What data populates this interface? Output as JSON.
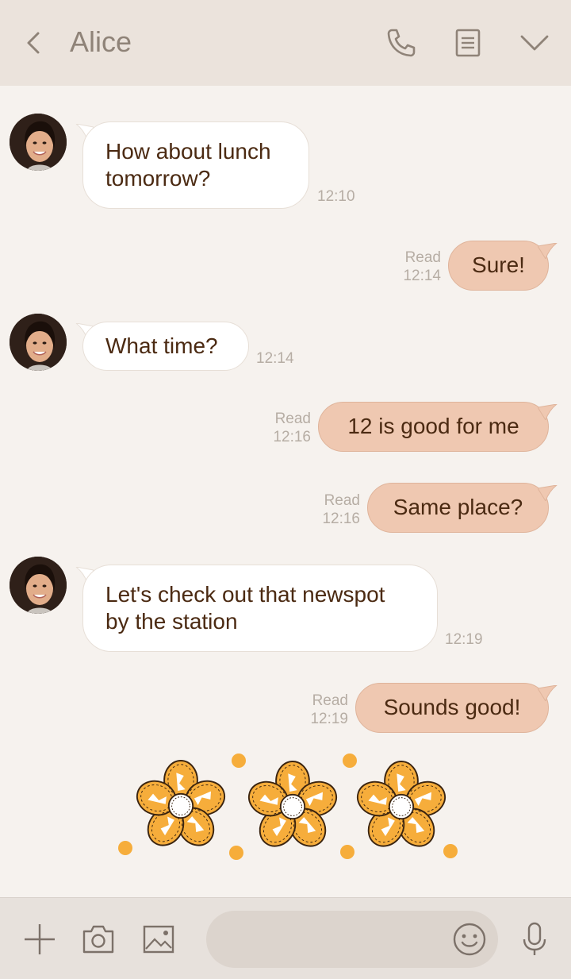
{
  "header": {
    "title": "Alice",
    "icons": [
      "back-icon",
      "phone-icon",
      "notes-icon",
      "chevron-down-icon"
    ]
  },
  "messages": [
    {
      "direction": "in",
      "text": "How about lunch\ntomorrow?",
      "time": "12:10"
    },
    {
      "direction": "out",
      "text": "Sure!",
      "read": "Read",
      "time": "12:14"
    },
    {
      "direction": "in",
      "text": "What time?",
      "time": "12:14"
    },
    {
      "direction": "out",
      "text": "12 is good for me",
      "read": "Read",
      "time": "12:16"
    },
    {
      "direction": "out",
      "text": "Same place?",
      "read": "Read",
      "time": "12:16"
    },
    {
      "direction": "in",
      "text": "Let's check out that newspot\nby the station",
      "time": "12:19"
    },
    {
      "direction": "out",
      "text": "Sounds good!",
      "read": "Read",
      "time": "12:19"
    }
  ],
  "sticker": {
    "name": "orange-flowers-sticker"
  },
  "footer": {
    "input_value": "",
    "icons": [
      "plus-icon",
      "camera-icon",
      "image-icon",
      "emoji-icon",
      "microphone-icon"
    ]
  },
  "colors": {
    "background": "#f6f2ee",
    "header": "#ebe3dc",
    "incoming_bubble": "#ffffff",
    "outgoing_bubble": "#efc8b1",
    "text": "#4b2a12",
    "meta": "#b6ada4",
    "flower": "#f6ad3b"
  }
}
